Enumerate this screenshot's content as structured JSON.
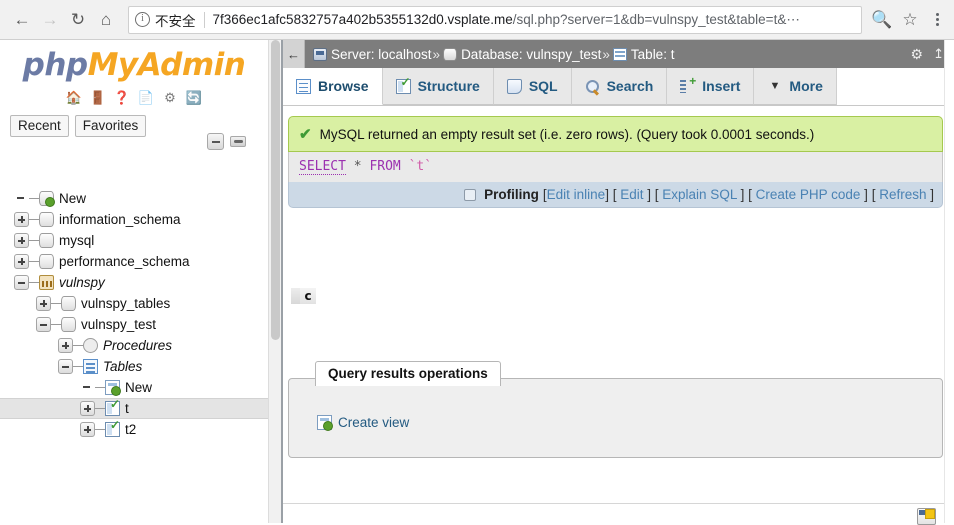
{
  "browser": {
    "back_icon": "back-arrow-icon",
    "forward_icon": "forward-arrow-icon",
    "reload_icon": "reload-icon",
    "home_icon": "home-icon",
    "info_glyph": "i",
    "security_label": "不安全",
    "url_host": "7f366ec1afc5832757a402b5355132d0.vsplate.me",
    "url_path": "/sql.php?server=1&db=vulnspy_test&table=t&⋯",
    "zoom_icon": "zoom-icon",
    "bookmark_icon": "star-icon",
    "menu_icon": "kebab-menu-icon"
  },
  "sidebar": {
    "logo_php": "php",
    "logo_myadmin": "MyAdmin",
    "logo_icons": [
      {
        "name": "home-icon",
        "glyph": "🏠"
      },
      {
        "name": "logout-icon",
        "glyph": "🚪"
      },
      {
        "name": "help-icon",
        "glyph": "❓"
      },
      {
        "name": "documentation-icon",
        "glyph": "📄"
      },
      {
        "name": "settings-gear-icon",
        "glyph": "⚙"
      },
      {
        "name": "reload-icon",
        "glyph": "🔄"
      }
    ],
    "quick_links": [
      "Recent",
      "Favorites"
    ],
    "collapse_label": "collapse-all-button",
    "link_label": "link-with-main-panel-button",
    "tree": [
      {
        "label": "New",
        "indent": 0,
        "toggle": "none",
        "icon": "db-new-icon",
        "italic": false,
        "selected": false
      },
      {
        "label": "information_schema",
        "indent": 0,
        "toggle": "plus",
        "icon": "db-icon",
        "italic": false,
        "selected": false
      },
      {
        "label": "mysql",
        "indent": 0,
        "toggle": "plus",
        "icon": "db-icon",
        "italic": false,
        "selected": false
      },
      {
        "label": "performance_schema",
        "indent": 0,
        "toggle": "plus",
        "icon": "db-icon",
        "italic": false,
        "selected": false
      },
      {
        "label": "vulnspy",
        "indent": 0,
        "toggle": "minus",
        "icon": "db-chart-icon",
        "italic": true,
        "selected": false
      },
      {
        "label": "vulnspy_tables",
        "indent": 1,
        "toggle": "plus",
        "icon": "db-icon",
        "italic": false,
        "selected": false
      },
      {
        "label": "vulnspy_test",
        "indent": 1,
        "toggle": "minus",
        "icon": "db-icon",
        "italic": false,
        "selected": false
      },
      {
        "label": "Procedures",
        "indent": 2,
        "toggle": "plus",
        "icon": "procedure-icon",
        "italic": true,
        "selected": false
      },
      {
        "label": "Tables",
        "indent": 2,
        "toggle": "minus",
        "icon": "tables-icon",
        "italic": true,
        "selected": false
      },
      {
        "label": "New",
        "indent": 3,
        "toggle": "none",
        "icon": "table-new-icon",
        "italic": false,
        "selected": false
      },
      {
        "label": "t",
        "indent": 3,
        "toggle": "plus",
        "icon": "table-icon",
        "italic": false,
        "selected": true
      },
      {
        "label": "t2",
        "indent": 3,
        "toggle": "plus",
        "icon": "table-icon",
        "italic": false,
        "selected": false
      }
    ]
  },
  "main": {
    "back_arrow": "←",
    "breadcrumb": {
      "server": "Server: localhost",
      "database": "Database: vulnspy_test",
      "table": "Table: t",
      "separator": "»"
    },
    "settings_icon": "gear-icon",
    "collapse_icon": "collapse-panel-icon",
    "tabs": [
      {
        "label": "Browse",
        "icon": "browse-icon",
        "active": true
      },
      {
        "label": "Structure",
        "icon": "structure-icon",
        "active": false
      },
      {
        "label": "SQL",
        "icon": "sql-icon",
        "active": false
      },
      {
        "label": "Search",
        "icon": "search-icon",
        "active": false
      },
      {
        "label": "Insert",
        "icon": "insert-icon",
        "active": false
      },
      {
        "label": "More",
        "icon": "chevron-down-icon",
        "active": false
      }
    ],
    "result": {
      "check_icon": "✔",
      "message": "MySQL returned an empty result set (i.e. zero rows). (Query took 0.0001 seconds.)",
      "sql": {
        "keyword1": "SELECT",
        "star": "*",
        "keyword2": "FROM",
        "table": "`t`"
      },
      "profiling_label": "Profiling",
      "actions": [
        {
          "open": "[",
          "label": "Edit inline",
          "close": "]"
        },
        {
          "open": "[",
          "label": "Edit",
          "close": "]"
        },
        {
          "open": "[",
          "label": "Explain SQL",
          "close": "]"
        },
        {
          "open": "[",
          "label": "Create PHP code",
          "close": "]"
        },
        {
          "open": "[",
          "label": "Refresh",
          "close": "]"
        }
      ]
    },
    "copy_marker": "c",
    "operations": {
      "legend": "Query results operations",
      "create_view": "Create view",
      "create_view_icon": "create-view-icon"
    },
    "console_icon": "console-icon"
  },
  "colors": {
    "accent_blue": "#235a81",
    "link_blue": "#4a82b3",
    "success_bg": "#d9f0a3",
    "crumb_bg": "#7d7d7d",
    "sql_keyword": "#9b30b0",
    "logo_orange": "#f5a623",
    "logo_blue": "#6c7ba5"
  }
}
